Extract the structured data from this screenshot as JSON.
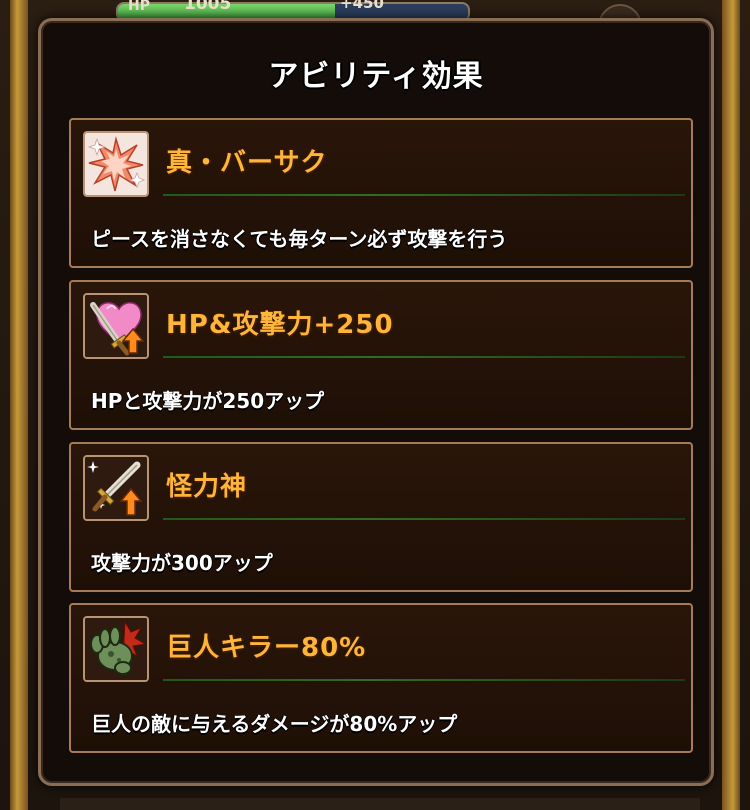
{
  "background": {
    "hp_label": "HP",
    "hp_value": "1005",
    "hp_sub_value": "+450",
    "hp_fill_fraction": 0.62
  },
  "modal": {
    "title": "アビリティ効果",
    "abilities": [
      {
        "name": "真・バーサク",
        "description": "ピースを消さなくても毎ターン必ず攻撃を行う",
        "icon": "burst-icon"
      },
      {
        "name": "HP&攻撃力+250",
        "description": "HPと攻撃力が250アップ",
        "icon": "heart-sword-up-icon"
      },
      {
        "name": "怪力神",
        "description": "攻撃力が300アップ",
        "icon": "sword-up-icon"
      },
      {
        "name": "巨人キラー80%",
        "description": "巨人の敵に与えるダメージが80%アップ",
        "icon": "giant-hand-icon"
      }
    ]
  },
  "colors": {
    "ability_name": "#ffb43a",
    "card_border": "#a57c57",
    "modal_border": "#8a6d55"
  }
}
